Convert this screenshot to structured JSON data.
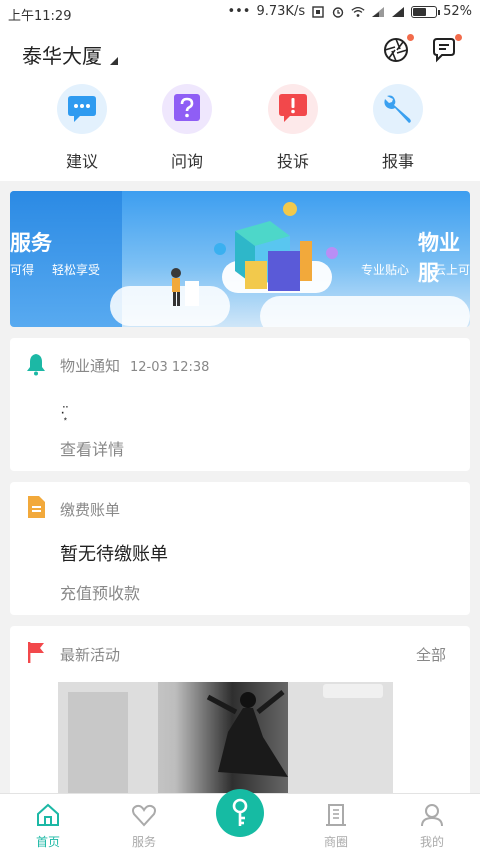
{
  "status_bar": {
    "time": "上午11:29",
    "network_speed": "9.73K/s",
    "battery": "52%"
  },
  "header": {
    "building_name": "泰华大厦"
  },
  "quick_actions": [
    {
      "label": "建议",
      "icon": "chat-bubble-icon",
      "color": "#2f9bf0"
    },
    {
      "label": "问询",
      "icon": "question-icon",
      "color": "#8f5ef5"
    },
    {
      "label": "投诉",
      "icon": "alert-icon",
      "color": "#f2484b"
    },
    {
      "label": "报事",
      "icon": "wrench-icon",
      "color": "#3aa0f0"
    }
  ],
  "banner": {
    "left_title": "服务",
    "left_sub_1": "可得",
    "left_sub_2": "轻松享受",
    "right_title": "物业服",
    "right_sub_1": "专业贴心",
    "right_sub_2": "云上可"
  },
  "notice": {
    "title": "物业通知",
    "time": "12-03 12:38",
    "content": "·͙̈",
    "link": "查看详情"
  },
  "bill": {
    "title": "缴费账单",
    "status": "暂无待缴账单",
    "link": "充值预收款"
  },
  "activity": {
    "title": "最新活动",
    "all_label": "全部"
  },
  "bottom_nav": {
    "items": [
      {
        "label": "首页",
        "icon": "home-icon",
        "active": true
      },
      {
        "label": "服务",
        "icon": "heart-icon",
        "active": false
      },
      {
        "label": "商圈",
        "icon": "building-icon",
        "active": false
      },
      {
        "label": "我的",
        "icon": "user-icon",
        "active": false
      }
    ],
    "center_icon": "key-icon"
  },
  "colors": {
    "accent": "#1cb8a5",
    "notification_dot": "#f26b4b"
  }
}
